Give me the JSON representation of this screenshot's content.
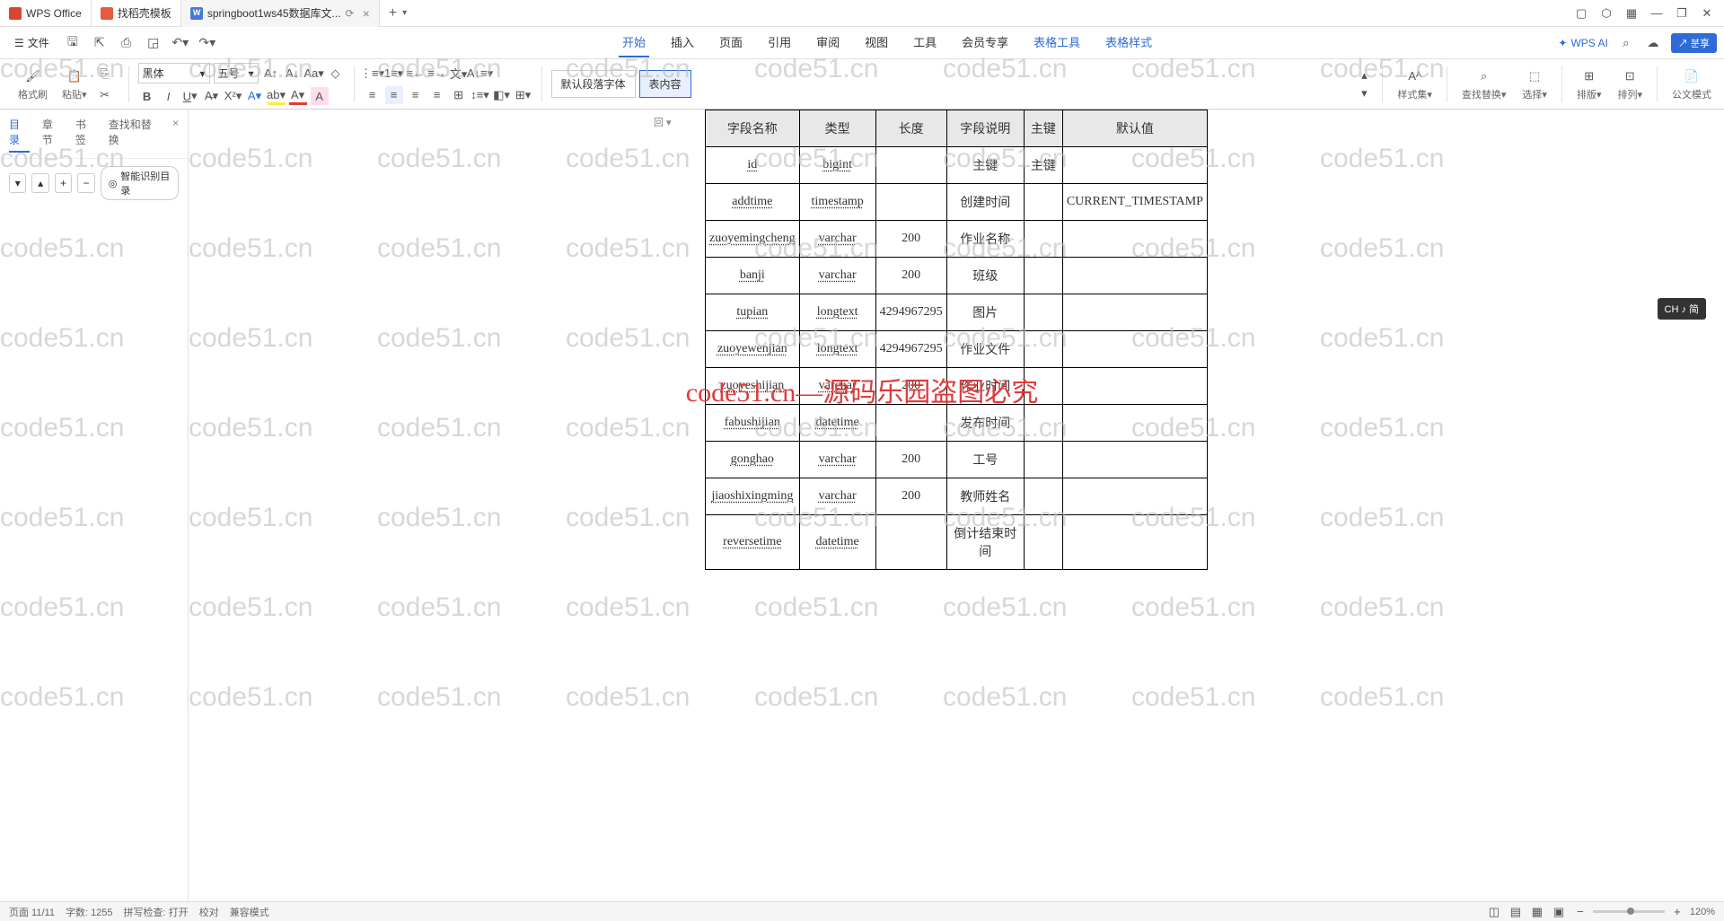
{
  "tabs": {
    "wps": "WPS Office",
    "tpl": "找稻壳模板",
    "doc": "springboot1ws45数据库文...",
    "reload": "⟳"
  },
  "file_menu": "文件",
  "menu": {
    "start": "开始",
    "insert": "插入",
    "page": "页面",
    "ref": "引用",
    "review": "审阅",
    "view": "视图",
    "tools": "工具",
    "member": "会员专享",
    "table_tools": "表格工具",
    "table_style": "表格样式"
  },
  "ai": "WPS AI",
  "share": "분享",
  "ribbon": {
    "format_painter": "格式刷",
    "paste": "粘贴",
    "font": "黑体",
    "size": "五号",
    "style1": "默认段落字体",
    "style2": "表内容",
    "style_set": "样式集",
    "find_replace": "查找替换",
    "select": "选择",
    "layout": "排版",
    "arrange": "排列",
    "gov_mode": "公文模式"
  },
  "sidebar": {
    "toc": "目录",
    "chapter": "章节",
    "bookmark": "书签",
    "findrep": "查找和替换",
    "smart": "智能识别目录"
  },
  "outline_btn": "回",
  "columns": [
    "字段名称",
    "类型",
    "长度",
    "字段说明",
    "主键",
    "默认值"
  ],
  "rows": [
    {
      "n": "id",
      "t": "bigint",
      "l": "",
      "d": "主键",
      "k": "主键",
      "v": ""
    },
    {
      "n": "addtime",
      "t": "timestamp",
      "l": "",
      "d": "创建时间",
      "k": "",
      "v": "CURRENT_TIMESTAMP"
    },
    {
      "n": "zuoyemingcheng",
      "t": "varchar",
      "l": "200",
      "d": "作业名称",
      "k": "",
      "v": ""
    },
    {
      "n": "banji",
      "t": "varchar",
      "l": "200",
      "d": "班级",
      "k": "",
      "v": ""
    },
    {
      "n": "tupian",
      "t": "longtext",
      "l": "4294967295",
      "d": "图片",
      "k": "",
      "v": ""
    },
    {
      "n": "zuoyewenjian",
      "t": "longtext",
      "l": "4294967295",
      "d": "作业文件",
      "k": "",
      "v": ""
    },
    {
      "n": "zuoyeshijian",
      "t": "varchar",
      "l": "200",
      "d": "作业时间",
      "k": "",
      "v": ""
    },
    {
      "n": "fabushijian",
      "t": "datetime",
      "l": "",
      "d": "发布时间",
      "k": "",
      "v": ""
    },
    {
      "n": "gonghao",
      "t": "varchar",
      "l": "200",
      "d": "工号",
      "k": "",
      "v": ""
    },
    {
      "n": "jiaoshixingming",
      "t": "varchar",
      "l": "200",
      "d": "教师姓名",
      "k": "",
      "v": ""
    },
    {
      "n": "reversetime",
      "t": "datetime",
      "l": "",
      "d": "倒计结束时间",
      "k": "",
      "v": ""
    }
  ],
  "watermark_text": "code51.cn",
  "red_wm": "code51.cn—源码乐园盗图必究",
  "ime": "CH ♪ 简",
  "status": {
    "page": "页面 11/11",
    "words": "字数: 1255",
    "spell": "拼写检查: 打开",
    "proofing": "校对",
    "comment": "兼容模式",
    "zoom": "120%"
  }
}
